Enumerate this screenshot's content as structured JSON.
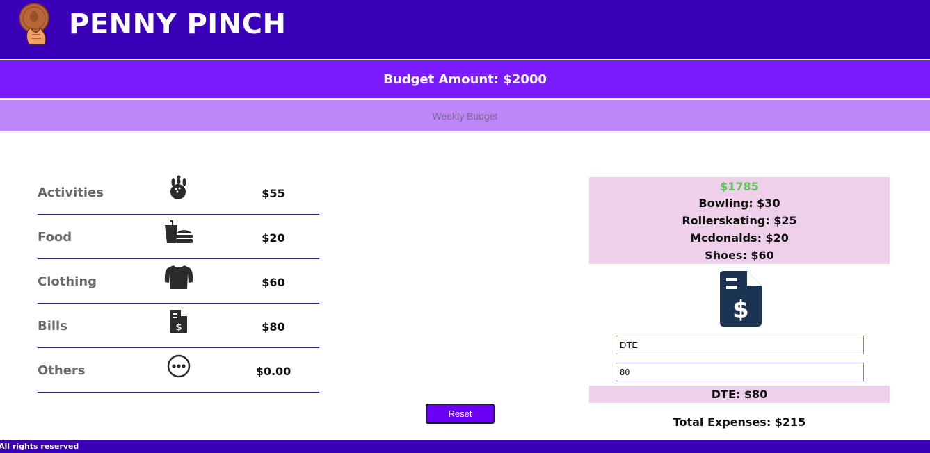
{
  "header": {
    "title": "PENNY PINCH",
    "logo_icon": "penny-coin-hand-logo",
    "background_color": "#3a00b8"
  },
  "budget": {
    "label": "Budget Amount: $2000",
    "background_color": "#7a1bff"
  },
  "weekly": {
    "label": "Weekly Budget",
    "background_color": "#bf86fa"
  },
  "categories": [
    {
      "name": "Activities",
      "icon": "bowling-icon",
      "amount": "$55"
    },
    {
      "name": "Food",
      "icon": "fast-food-icon",
      "amount": "$20"
    },
    {
      "name": "Clothing",
      "icon": "shirt-icon",
      "amount": "$60"
    },
    {
      "name": "Bills",
      "icon": "invoice-icon",
      "amount": "$80"
    },
    {
      "name": "Others",
      "icon": "ellipsis-icon",
      "amount": "$0.00"
    }
  ],
  "actions": {
    "reset_label": "Reset"
  },
  "summary": {
    "remaining": "$1785",
    "remaining_color": "#5fc45a",
    "expenses": [
      "Bowling: $30",
      "Rollerskating: $25",
      "Mcdonalds: $20",
      "Shoes: $60"
    ],
    "category_icon": "invoice-icon",
    "icon_color": "#1b3352"
  },
  "form": {
    "name_value": "DTE",
    "amount_value": "80",
    "entry_label": "DTE: $80"
  },
  "totals": {
    "label": "Total Expenses: $215"
  },
  "footer": {
    "text": "All rights reserved"
  }
}
